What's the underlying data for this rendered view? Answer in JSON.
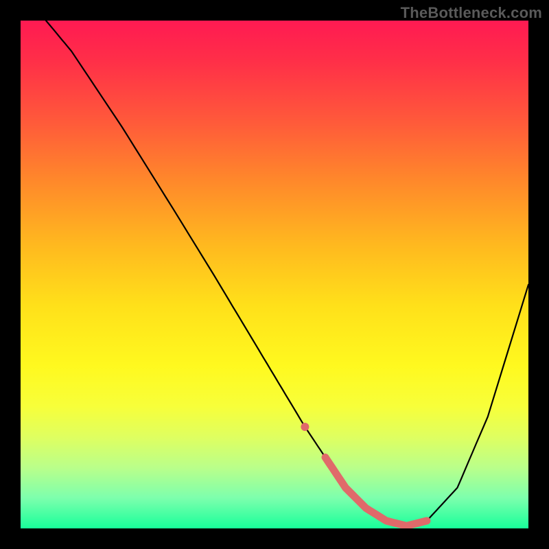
{
  "watermark": "TheBottleneck.com",
  "colors": {
    "background": "#000000",
    "curve_stroke": "#000000",
    "marker_stroke": "#e06a6a",
    "gradient_top": "#ff1a52",
    "gradient_bottom": "#18ff9a"
  },
  "chart_data": {
    "type": "line",
    "title": "",
    "xlabel": "",
    "ylabel": "",
    "xlim": [
      0,
      100
    ],
    "ylim": [
      0,
      100
    ],
    "grid": false,
    "legend_position": "none",
    "series": [
      {
        "name": "curve",
        "x": [
          5,
          10,
          20,
          30,
          38,
          44,
          50,
          56,
          60,
          64,
          68,
          72,
          76,
          80,
          86,
          92,
          100
        ],
        "values": [
          100,
          94,
          79,
          63,
          50,
          40,
          30,
          20,
          14,
          8,
          4,
          1.5,
          0.5,
          1.5,
          8,
          22,
          48
        ]
      }
    ],
    "highlight": {
      "description": "salmon segment near minimum",
      "x": [
        56,
        60,
        64,
        68,
        72,
        76,
        80
      ],
      "values": [
        20,
        14,
        8,
        4,
        1.5,
        0.5,
        1.5
      ]
    }
  }
}
